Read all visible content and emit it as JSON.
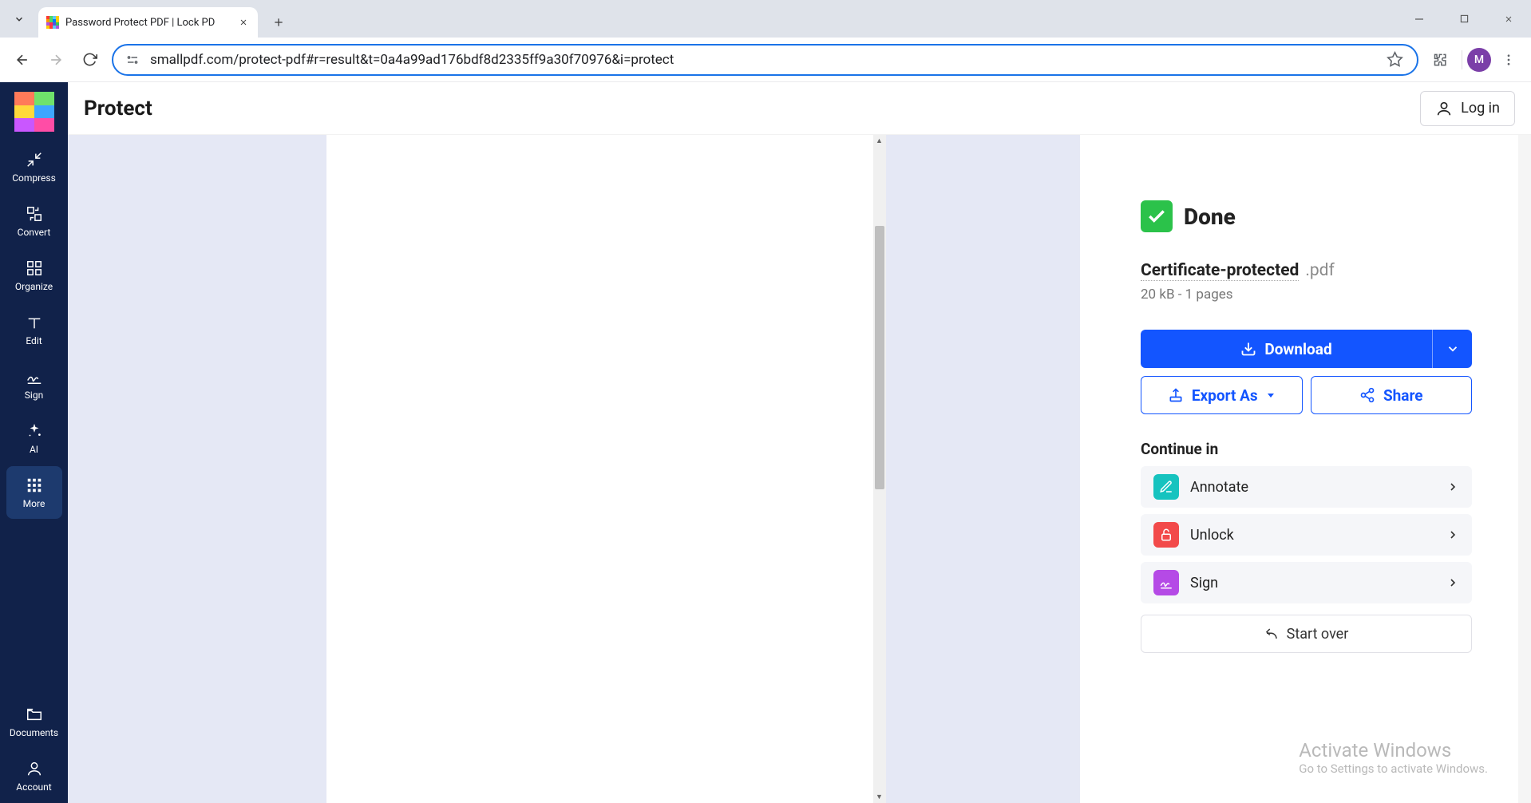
{
  "browser": {
    "tab_title": "Password Protect PDF | Lock PD",
    "url": "smallpdf.com/protect-pdf#r=result&t=0a4a99ad176bdf8d2335ff9a30f70976&i=protect",
    "avatar_initial": "M"
  },
  "header": {
    "page_title": "Protect",
    "login_label": "Log in"
  },
  "sidebar": {
    "items": [
      {
        "label": "Compress"
      },
      {
        "label": "Convert"
      },
      {
        "label": "Organize"
      },
      {
        "label": "Edit"
      },
      {
        "label": "Sign"
      },
      {
        "label": "AI"
      },
      {
        "label": "More"
      },
      {
        "label": "Documents"
      },
      {
        "label": "Account"
      }
    ]
  },
  "result": {
    "done_label": "Done",
    "file_name": "Certificate-protected",
    "file_ext": ".pdf",
    "file_meta": "20 kB - 1 pages",
    "download_label": "Download",
    "export_label": "Export As",
    "share_label": "Share",
    "continue_label": "Continue in",
    "continue_items": [
      {
        "label": "Annotate"
      },
      {
        "label": "Unlock"
      },
      {
        "label": "Sign"
      }
    ],
    "start_over_label": "Start over"
  },
  "watermark": {
    "line1": "Activate Windows",
    "line2": "Go to Settings to activate Windows."
  },
  "colors": {
    "accent_blue": "#1355ff",
    "sidebar_bg": "#11224a",
    "success_green": "#2bc24a"
  }
}
